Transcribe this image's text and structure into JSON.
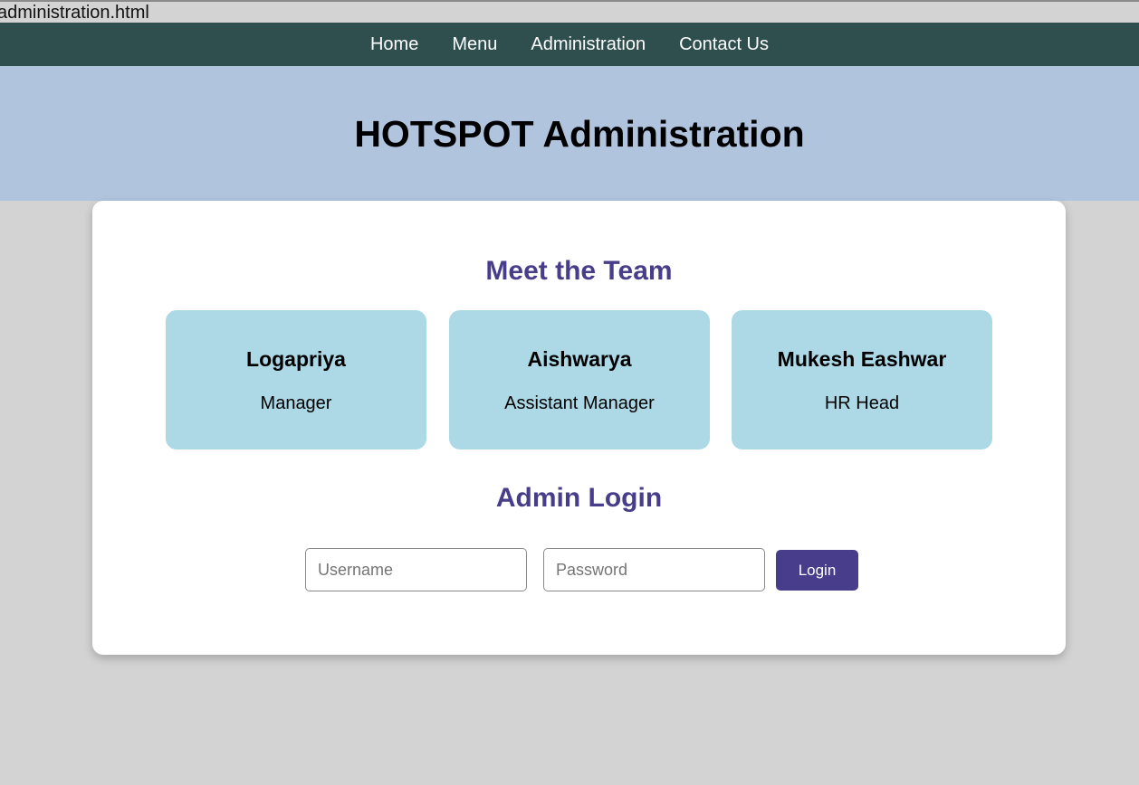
{
  "browser": {
    "tab_title": "administration.html"
  },
  "nav": {
    "items": [
      {
        "label": "Home"
      },
      {
        "label": "Menu"
      },
      {
        "label": "Administration"
      },
      {
        "label": "Contact Us"
      }
    ]
  },
  "hero": {
    "title": "HOTSPOT Administration"
  },
  "team": {
    "heading": "Meet the Team",
    "members": [
      {
        "name": "Logapriya",
        "role": "Manager"
      },
      {
        "name": "Aishwarya",
        "role": "Assistant Manager"
      },
      {
        "name": "Mukesh Eashwar",
        "role": "HR Head"
      }
    ]
  },
  "login": {
    "heading": "Admin Login",
    "username_placeholder": "Username",
    "username_value": "",
    "password_placeholder": "Password",
    "password_value": "",
    "button_label": "Login"
  },
  "colors": {
    "navbar": "#2f4f4f",
    "hero_background": "#b0c4de",
    "page_background": "#d3d3d3",
    "card_background": "#add8e6",
    "accent": "#483d8b"
  }
}
